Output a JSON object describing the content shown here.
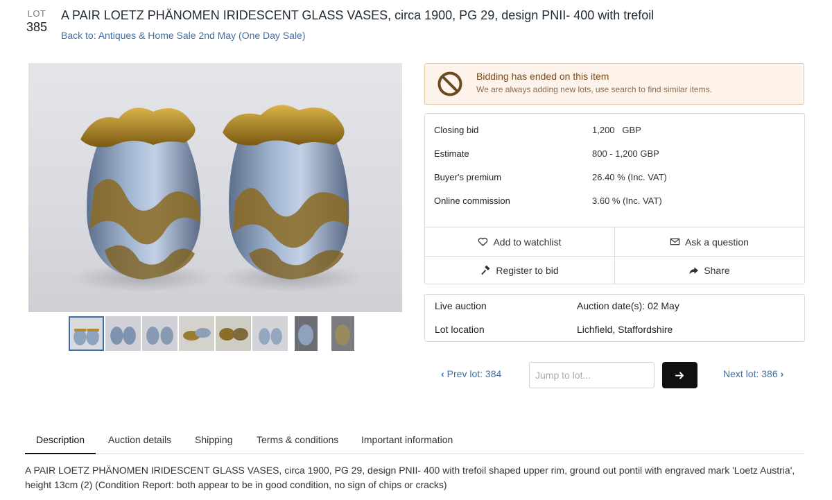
{
  "lot": {
    "label": "LOT",
    "number": "385"
  },
  "title": "A PAIR LOETZ PHÄNOMEN IRIDESCENT GLASS VASES, circa 1900, PG 29, design PNII- 400 with trefoil",
  "back_link": "Back to: Antiques & Home Sale 2nd May (One Day Sale)",
  "gallery": {
    "main_image_alt": "Pair of Loetz iridescent glass vases",
    "thumbnail_count": 8,
    "active_thumbnail": 1
  },
  "bidding_status": {
    "title": "Bidding has ended on this item",
    "subtitle": "We are always adding new lots, use search to find similar items."
  },
  "bid_details": {
    "closing_bid_label": "Closing bid",
    "closing_bid_value": "1,200   GBP",
    "estimate_label": "Estimate",
    "estimate_value": "800 - 1,200 GBP",
    "buyers_premium_label": "Buyer's premium",
    "buyers_premium_value": "26.40 % (Inc. VAT)",
    "online_commission_label": "Online commission",
    "online_commission_value": "3.60 % (Inc. VAT)"
  },
  "actions": {
    "watchlist": "Add to watchlist",
    "ask": "Ask a question",
    "register": "Register to bid",
    "share": "Share"
  },
  "auction_info": {
    "type_label": "Live auction",
    "date_value": "Auction date(s): 02 May",
    "location_label": "Lot location",
    "location_value": "Lichfield, Staffordshire"
  },
  "navigation": {
    "prev": "Prev lot: 384",
    "jump_placeholder": "Jump to lot...",
    "next": "Next lot: 386"
  },
  "tabs": [
    "Description",
    "Auction details",
    "Shipping",
    "Terms & conditions",
    "Important information"
  ],
  "description": "A PAIR LOETZ PHÄNOMEN IRIDESCENT GLASS VASES, circa 1900, PG 29, design PNII- 400 with trefoil shaped upper rim, ground out pontil with engraved mark 'Loetz Austria', height 13cm (2) (Condition Report: both appear to be in good condition, no sign of chips or cracks)",
  "colors": {
    "link": "#3d6fa6",
    "ended_bg": "#fdf3ea",
    "ended_border": "#e6c9a8",
    "ended_text": "#7a4a1e",
    "go_button": "#111111"
  }
}
